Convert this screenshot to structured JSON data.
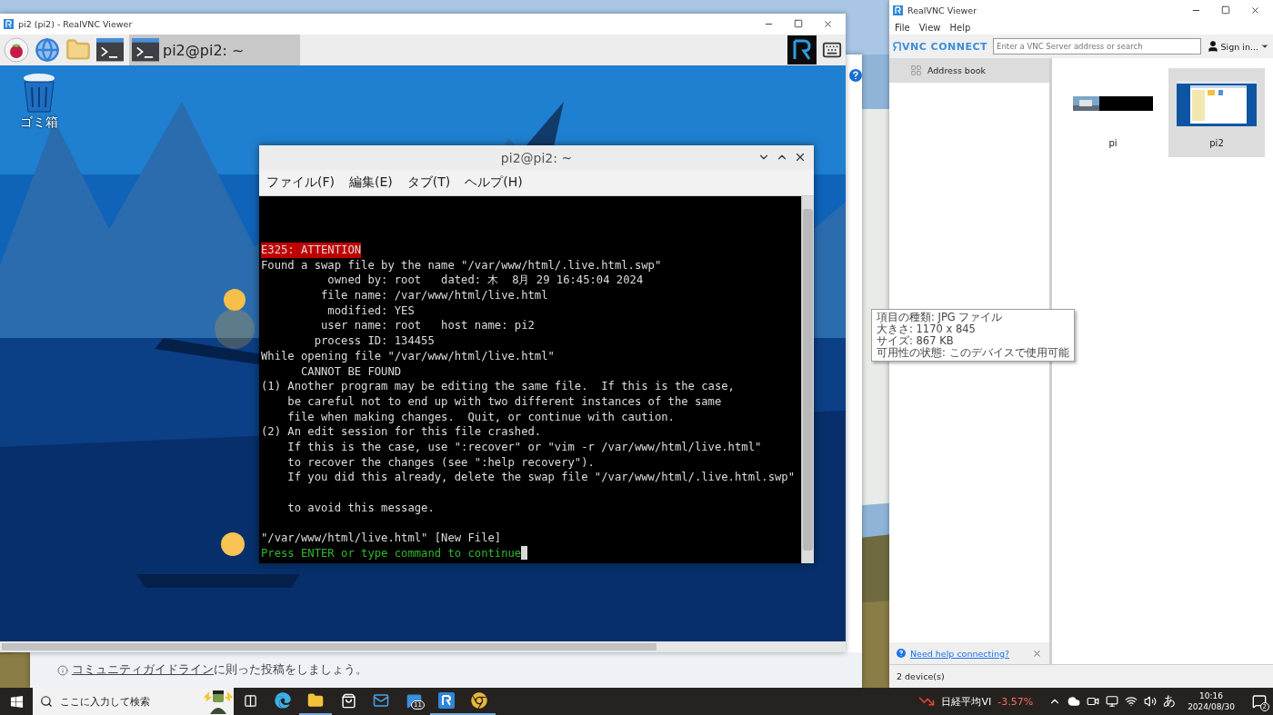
{
  "window_behind": {
    "notice": {
      "link": "コミュニティガイドライン",
      "text": "に則った投稿をしましょう。"
    }
  },
  "session_window": {
    "title": "pi2 (pi2) - RealVNC Viewer",
    "panel": {
      "tasks": [
        {
          "label": "pi2@pi2: ~",
          "selected": true
        }
      ]
    },
    "desktop_icons": [
      {
        "label": "ゴミ箱"
      }
    ],
    "terminal": {
      "title": "pi2@pi2: ~",
      "menu": [
        "ファイル(F)",
        "編集(E)",
        "タブ(T)",
        "ヘルプ(H)"
      ],
      "lines": [
        {
          "kind": "alert",
          "text": "E325: ATTENTION"
        },
        {
          "kind": "normal",
          "text": "Found a swap file by the name \"/var/www/html/.live.html.swp\""
        },
        {
          "kind": "normal",
          "text": "          owned by: root   dated: 木  8月 29 16:45:04 2024"
        },
        {
          "kind": "normal",
          "text": "         file name: /var/www/html/live.html"
        },
        {
          "kind": "normal",
          "text": "          modified: YES"
        },
        {
          "kind": "normal",
          "text": "         user name: root   host name: pi2"
        },
        {
          "kind": "normal",
          "text": "        process ID: 134455"
        },
        {
          "kind": "normal",
          "text": "While opening file \"/var/www/html/live.html\""
        },
        {
          "kind": "normal",
          "text": "      CANNOT BE FOUND"
        },
        {
          "kind": "normal",
          "text": "(1) Another program may be editing the same file.  If this is the case,"
        },
        {
          "kind": "normal",
          "text": "    be careful not to end up with two different instances of the same"
        },
        {
          "kind": "normal",
          "text": "    file when making changes.  Quit, or continue with caution."
        },
        {
          "kind": "normal",
          "text": "(2) An edit session for this file crashed."
        },
        {
          "kind": "normal",
          "text": "    If this is the case, use \":recover\" or \"vim -r /var/www/html/live.html\""
        },
        {
          "kind": "normal",
          "text": "    to recover the changes (see \":help recovery\")."
        },
        {
          "kind": "normal",
          "text": "    If you did this already, delete the swap file \"/var/www/html/.live.html.swp\""
        },
        {
          "kind": "blank"
        },
        {
          "kind": "normal",
          "text": "    to avoid this message."
        },
        {
          "kind": "blank"
        },
        {
          "kind": "normal",
          "text": "\"/var/www/html/live.html\" [New File]"
        },
        {
          "kind": "prompt",
          "text": "Press ENTER or type command to continue"
        }
      ],
      "cursor": true
    }
  },
  "tooltip": {
    "lines": [
      "項目の種類: JPG ファイル",
      "大きさ: 1170 x 845",
      "サイズ: 867 KB",
      "可用性の状態: このデバイスで使用可能"
    ]
  },
  "viewer_window": {
    "title": "RealVNC Viewer",
    "menu": [
      "File",
      "View",
      "Help"
    ],
    "logo": "VNC CONNECT",
    "search": {
      "placeholder": "Enter a VNC Server address or search"
    },
    "account": "Sign in...",
    "sidebar": {
      "items": [
        {
          "label": "Address book",
          "selected": true
        }
      ]
    },
    "help_link": "Need help connecting?",
    "devices": [
      {
        "name": "pi",
        "selected": false
      },
      {
        "name": "pi2",
        "selected": true
      }
    ],
    "status": "2 device(s)"
  },
  "taskbar": {
    "search": {
      "placeholder": "ここに入力して検索"
    },
    "apps": [
      {
        "kind": "taskview",
        "running": false
      },
      {
        "kind": "edge",
        "running": false
      },
      {
        "kind": "explorer",
        "running": true
      },
      {
        "kind": "store",
        "running": false
      },
      {
        "kind": "mail",
        "running": false
      },
      {
        "kind": "chat",
        "running": false,
        "badge": "11"
      },
      {
        "kind": "vnc",
        "running": true
      },
      {
        "kind": "chrome",
        "running": true
      }
    ],
    "ticker": {
      "name": "日経平均VI",
      "change": "-3.57%"
    },
    "ime": "あ",
    "time": "10:16",
    "date": "2024/08/30",
    "notifications": "2"
  }
}
